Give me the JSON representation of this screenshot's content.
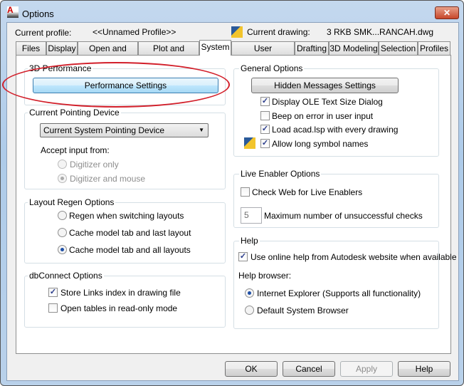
{
  "window": {
    "title": "Options",
    "close_icon": "close-icon"
  },
  "profile": {
    "label": "Current profile:",
    "value": "<<Unnamed Profile>>",
    "drawing_label": "Current drawing:",
    "drawing_value": "3 RKB SMK...RANCAH.dwg"
  },
  "tabs": [
    {
      "label": "Files"
    },
    {
      "label": "Display"
    },
    {
      "label": "Open and Save"
    },
    {
      "label": "Plot and Publish"
    },
    {
      "label": "System",
      "active": true
    },
    {
      "label": "User Preferences"
    },
    {
      "label": "Drafting"
    },
    {
      "label": "3D Modeling"
    },
    {
      "label": "Selection"
    },
    {
      "label": "Profiles"
    }
  ],
  "perf": {
    "title": "3D Performance",
    "button": "Performance Settings",
    "annotation_color": "#d21f2a"
  },
  "pointing": {
    "title": "Current Pointing Device",
    "device": "Current System Pointing Device",
    "accept_label": "Accept input from:",
    "options": [
      {
        "label": "Digitizer only",
        "selected": false
      },
      {
        "label": "Digitizer and mouse",
        "selected": true
      }
    ]
  },
  "regen": {
    "title": "Layout Regen Options",
    "options": [
      {
        "label": "Regen when switching layouts",
        "selected": false
      },
      {
        "label": "Cache model tab and last layout",
        "selected": false
      },
      {
        "label": "Cache model tab and all layouts",
        "selected": true
      }
    ]
  },
  "db": {
    "title": "dbConnect Options",
    "items": [
      {
        "label": "Store Links index in drawing file",
        "checked": true
      },
      {
        "label": "Open tables in read-only mode",
        "checked": false
      }
    ]
  },
  "general": {
    "title": "General Options",
    "button": "Hidden Messages Settings",
    "items": [
      {
        "label": "Display OLE Text Size Dialog",
        "checked": true
      },
      {
        "label": "Beep on error in user input",
        "checked": false
      },
      {
        "label": "Load acad.lsp with every drawing",
        "checked": true
      },
      {
        "label": "Allow long symbol names",
        "checked": true
      }
    ]
  },
  "live": {
    "title": "Live Enabler Options",
    "check": {
      "label": "Check Web for Live Enablers",
      "checked": false
    },
    "max_value": "5",
    "max_label": "Maximum number of unsuccessful checks"
  },
  "help": {
    "title": "Help",
    "check": {
      "label": "Use online help from Autodesk website when available",
      "checked": true
    },
    "browser_label": "Help browser:",
    "options": [
      {
        "label": "Internet Explorer (Supports all functionality)",
        "selected": true
      },
      {
        "label": "Default System Browser",
        "selected": false
      }
    ]
  },
  "footer": {
    "ok": "OK",
    "cancel": "Cancel",
    "apply": "Apply",
    "help": "Help"
  }
}
